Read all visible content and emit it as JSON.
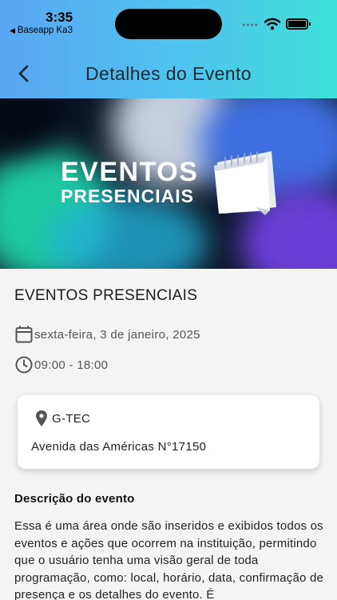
{
  "status_bar": {
    "time": "3:35",
    "back_app_label": "Baseapp Ka3"
  },
  "header": {
    "title": "Detalhes do Evento",
    "back_icon": "chevron-left-icon"
  },
  "banner": {
    "line1": "EVENTOS",
    "line2": "PRESENCIAIS"
  },
  "event": {
    "title": "EVENTOS PRESENCIAIS",
    "date": "sexta-feira, 3 de janeiro, 2025",
    "time_range": "09:00 - 18:00",
    "location_name": "G-TEC",
    "address": "Avenida das Américas N°17150",
    "description_heading": "Descrição do evento",
    "description": "Essa é uma área onde são inseridos e exibidos todos os eventos e ações que ocorrem na instituição, permitindo que o usuário tenha uma visão geral de toda programação, como: local, horário, data, confirmação de presença e os detalhes do evento. É"
  },
  "colors": {
    "header_gradient_start": "#5aa6f2",
    "header_gradient_end": "#3fe0d8",
    "background": "#f4f4f4"
  }
}
